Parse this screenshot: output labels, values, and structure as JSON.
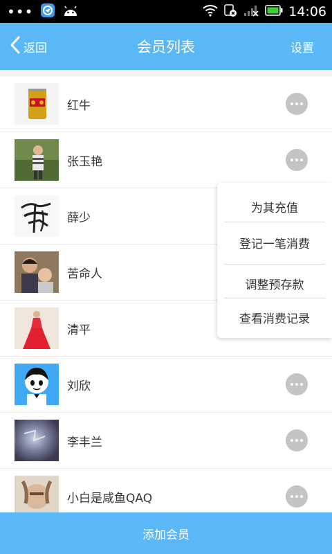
{
  "status_bar": {
    "time": "14:06",
    "dots": "•••",
    "icons": [
      "browser-app-icon",
      "android-icon",
      "wifi-icon",
      "no-sim-icon",
      "signal-icon",
      "battery-icon"
    ]
  },
  "nav": {
    "back_label": "返回",
    "title": "会员列表",
    "settings_label": "设置"
  },
  "members": [
    {
      "name": "红牛",
      "avatar": "red-bull-can-avatar"
    },
    {
      "name": "张玉艳",
      "avatar": "boy-outdoors-avatar"
    },
    {
      "name": "薛少",
      "avatar": "calligraphy-avatar"
    },
    {
      "name": "苦命人",
      "avatar": "mother-child-avatar"
    },
    {
      "name": "清平",
      "avatar": "red-dress-avatar"
    },
    {
      "name": "刘欣",
      "avatar": "cartoon-boy-avatar"
    },
    {
      "name": "李丰兰",
      "avatar": "blurry-photo-avatar"
    },
    {
      "name": "小白是咸鱼QAQ",
      "avatar": "hand-face-avatar"
    }
  ],
  "popup_menu": {
    "items": [
      "为其充值",
      "登记一笔消费",
      "调整预存款",
      "查看消费记录"
    ]
  },
  "bottom": {
    "add_member_label": "添加会员"
  },
  "colors": {
    "accent": "#5ab8f6",
    "more_button": "#c4c4c4",
    "status_bar": "#000000"
  }
}
